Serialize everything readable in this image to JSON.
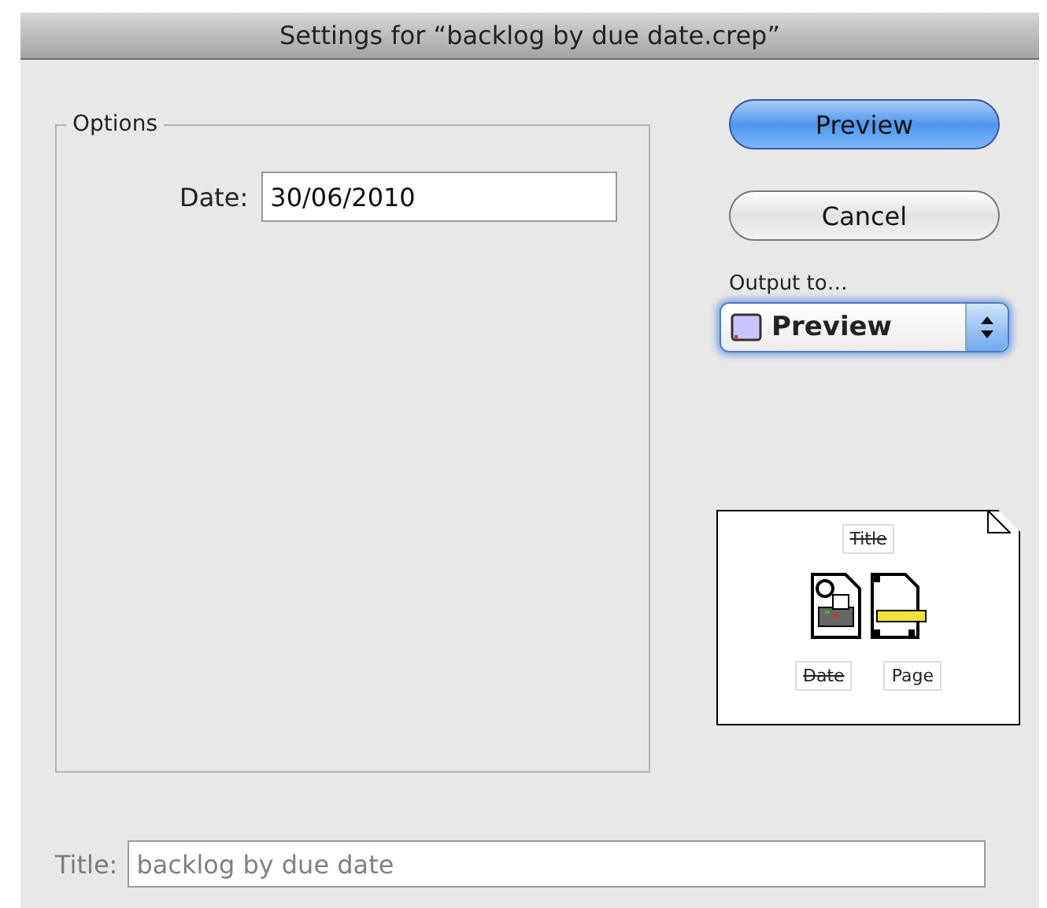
{
  "window": {
    "title": "Settings for “backlog by due date.crep”"
  },
  "options": {
    "legend": "Options",
    "date": {
      "label": "Date:",
      "value": "30/06/2010"
    }
  },
  "buttons": [
    {
      "label": "Preview",
      "default": true
    },
    {
      "label": "Cancel",
      "default": false
    }
  ],
  "output": {
    "label": "Output to…",
    "value": "Preview"
  },
  "page_layout": {
    "header": {
      "label": "Title",
      "enabled": false
    },
    "footer": [
      {
        "label": "Date",
        "enabled": false
      },
      {
        "label": "Page",
        "enabled": true
      }
    ]
  },
  "title_field": {
    "label": "Title:",
    "value": "backlog by due date",
    "disabled": true
  }
}
